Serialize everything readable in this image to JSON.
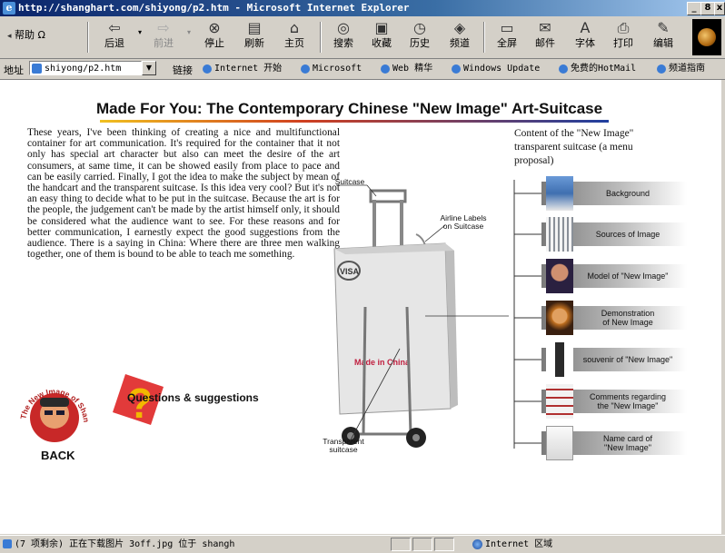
{
  "window": {
    "title": "http://shanghart.com/shiyong/p2.htm - Microsoft Internet Explorer",
    "controls": [
      "_",
      "8",
      "x"
    ]
  },
  "toolbar": {
    "buttons": [
      {
        "label": "帮助 Ω",
        "icon": "help-icon"
      },
      {
        "label": "后退",
        "icon": "back-arrow-icon"
      },
      {
        "label": "前进",
        "icon": "forward-arrow-icon"
      },
      {
        "label": "停止",
        "icon": "stop-icon"
      },
      {
        "label": "刷新",
        "icon": "refresh-icon"
      },
      {
        "label": "主页",
        "icon": "home-icon"
      },
      {
        "label": "搜索",
        "icon": "search-icon"
      },
      {
        "label": "收藏",
        "icon": "favorites-icon"
      },
      {
        "label": "历史",
        "icon": "history-icon"
      },
      {
        "label": "频道",
        "icon": "channels-icon"
      },
      {
        "label": "全屏",
        "icon": "fullscreen-icon"
      },
      {
        "label": "邮件",
        "icon": "mail-icon"
      },
      {
        "label": "字体",
        "icon": "font-icon"
      },
      {
        "label": "打印",
        "icon": "print-icon"
      },
      {
        "label": "编辑",
        "icon": "edit-icon"
      }
    ]
  },
  "addressbar": {
    "label": "地址",
    "value": "shiyong/p2.htm",
    "links_label": "链接",
    "links": [
      "Internet 开始",
      "Microsoft",
      "Web 精华",
      "Windows Update",
      "免费的HotMail",
      "频道指南"
    ]
  },
  "page": {
    "heading": "Made For You: The Contemporary Chinese \"New Image\" Art-Suitcase",
    "body": "These years, I've been thinking of creating a nice and multifunctional container for art communication. It's required for the container that it not only has special art character but also can meet the desire of the art consumers, at same time, it can be showed easily from place to pace and can be easily carried.    Finally, I got the idea to make the subject by mean of the handcart and the transparent suitcase. Is this idea very cool? But it's not an easy thing to decide what to be put in the suitcase. Because the art is for the people, the judgement can't be made by the artist himself only, it should be considered what the audience want to see.                For these reasons and for better communication, I earnestly expect the good suggestions from the audience. There is a saying in China: Where there are three men walking together, one of them is bound to be able to teach me something.",
    "back_label": "BACK",
    "logo_ring_text": "The New Image of Shanghai",
    "questions_label": "Questions & suggestions",
    "suitcase": {
      "suitcase_label": "Suitcase",
      "airline_label": "Airline Labels\non Suitcase",
      "visa_label": "VISA",
      "made_in_label": "Made in China",
      "transparent_label": "Transparent\nsuitcase"
    },
    "menu_title": "Content of the \"New Image\" transparent  suitcase (a menu proposal)",
    "menu": [
      {
        "label": "Background",
        "thumb_color": "#3f6fb0"
      },
      {
        "label": "Sources of  Image",
        "thumb_color": "#9aa0aa"
      },
      {
        "label": "Model of \"New Image\"",
        "thumb_color": "#4a3a60"
      },
      {
        "label": "Demonstration\nof New Image",
        "thumb_color": "#c07020"
      },
      {
        "label": "souvenir of  \"New Image\"",
        "thumb_color": "#2a2a2a"
      },
      {
        "label": "Comments regarding\nthe \"New Image\"",
        "thumb_color": "#b03030"
      },
      {
        "label": "Name card of\n\"New Image\"",
        "thumb_color": "#c8c8c8"
      }
    ]
  },
  "statusbar": {
    "text": "(7 项剩余) 正在下载图片 3off.jpg 位于 shangh",
    "zone": "Internet 区域"
  }
}
